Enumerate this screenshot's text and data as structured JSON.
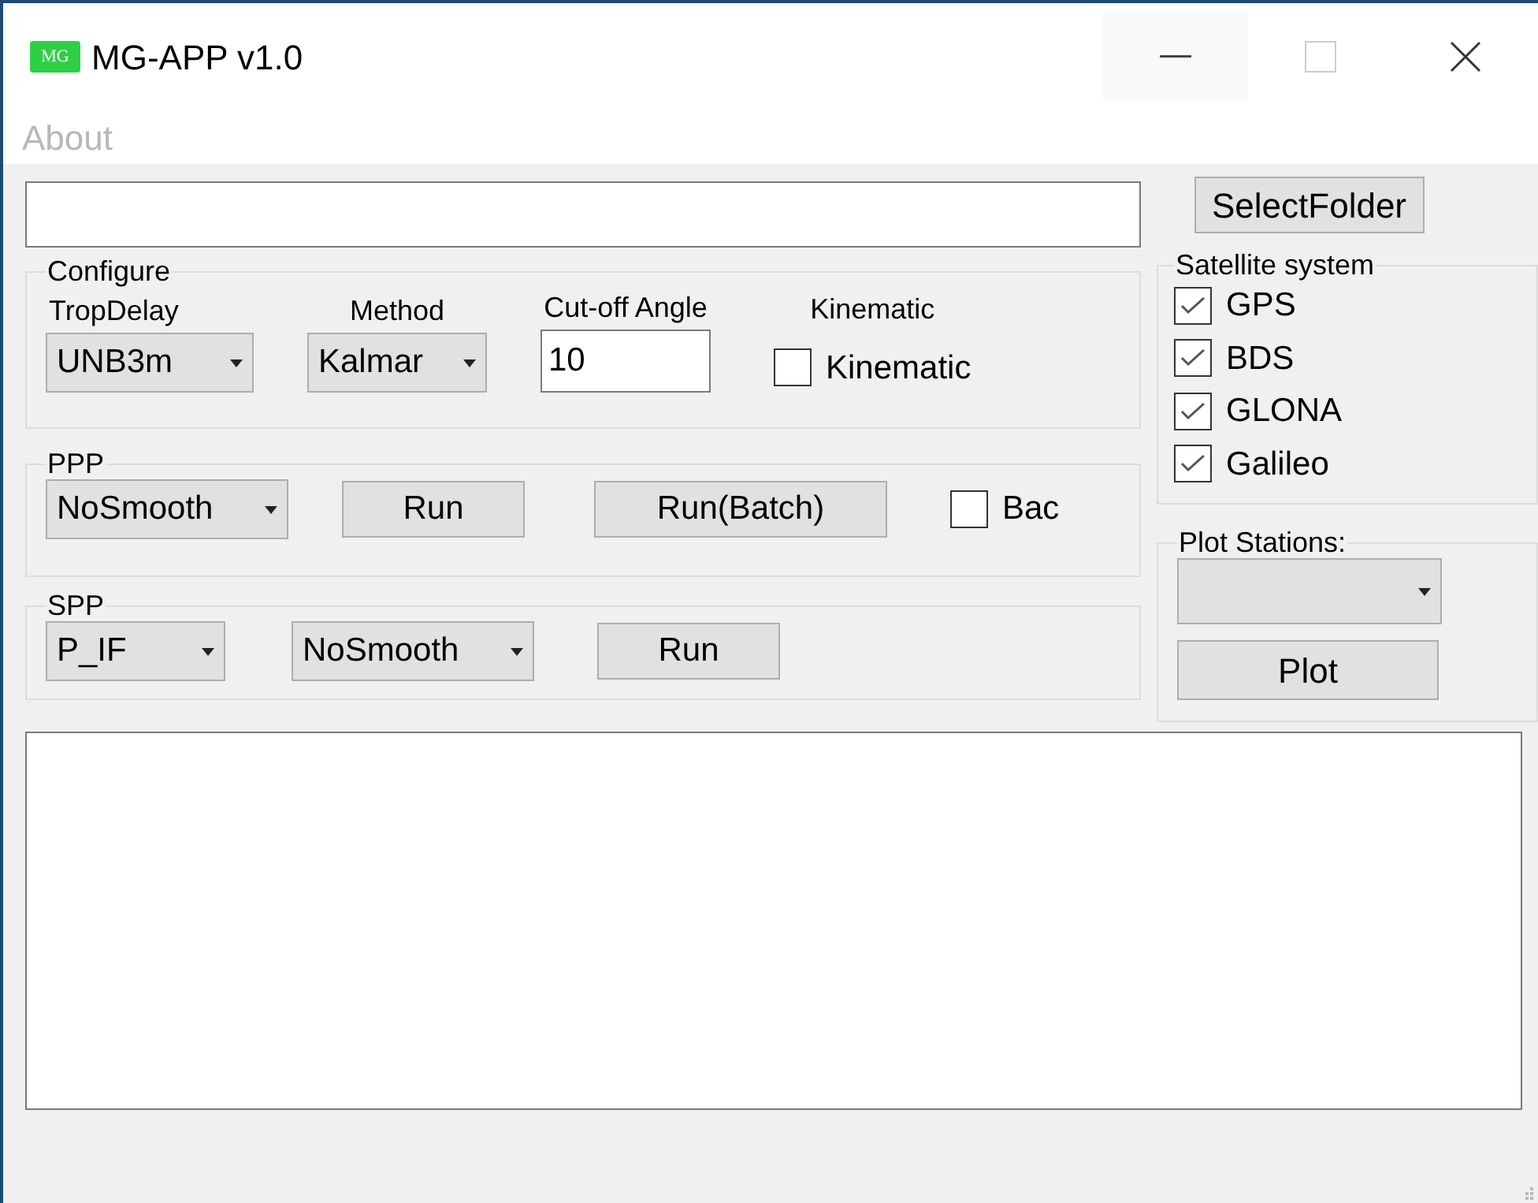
{
  "window": {
    "title": "MG-APP v1.0",
    "logo": "MG"
  },
  "menu": [
    {
      "label": "About",
      "disabled": true
    }
  ],
  "folder": {
    "button": "SelectFolder"
  },
  "configure": {
    "title": "Configure",
    "tropdelay": {
      "label": "TropDelay",
      "value": "UNB3m"
    },
    "method": {
      "label": "Method",
      "value": "Kalmar"
    },
    "cutoff": {
      "label": "Cut-off Angle",
      "value": "10"
    },
    "kinematic": {
      "label": "Kinematic",
      "checkbox_label": "Kinematic",
      "checked": false
    }
  },
  "ppp": {
    "title": "PPP",
    "smoothing": "NoSmooth",
    "run": "Run",
    "run_batch": "Run(Batch)",
    "backward": {
      "label": "Bac",
      "checked": false
    }
  },
  "spp": {
    "title": "SPP",
    "mode": "P_IF",
    "smoothing": "NoSmooth",
    "run": "Run"
  },
  "satellite_system": {
    "title": "Satellite system",
    "items": [
      {
        "label": "GPS",
        "checked": true
      },
      {
        "label": "BDS",
        "checked": true
      },
      {
        "label": "GLONA",
        "checked": true
      },
      {
        "label": "Galileo",
        "checked": true
      }
    ]
  },
  "plot_stations": {
    "title": "Plot Stations:",
    "button": "Plot"
  }
}
